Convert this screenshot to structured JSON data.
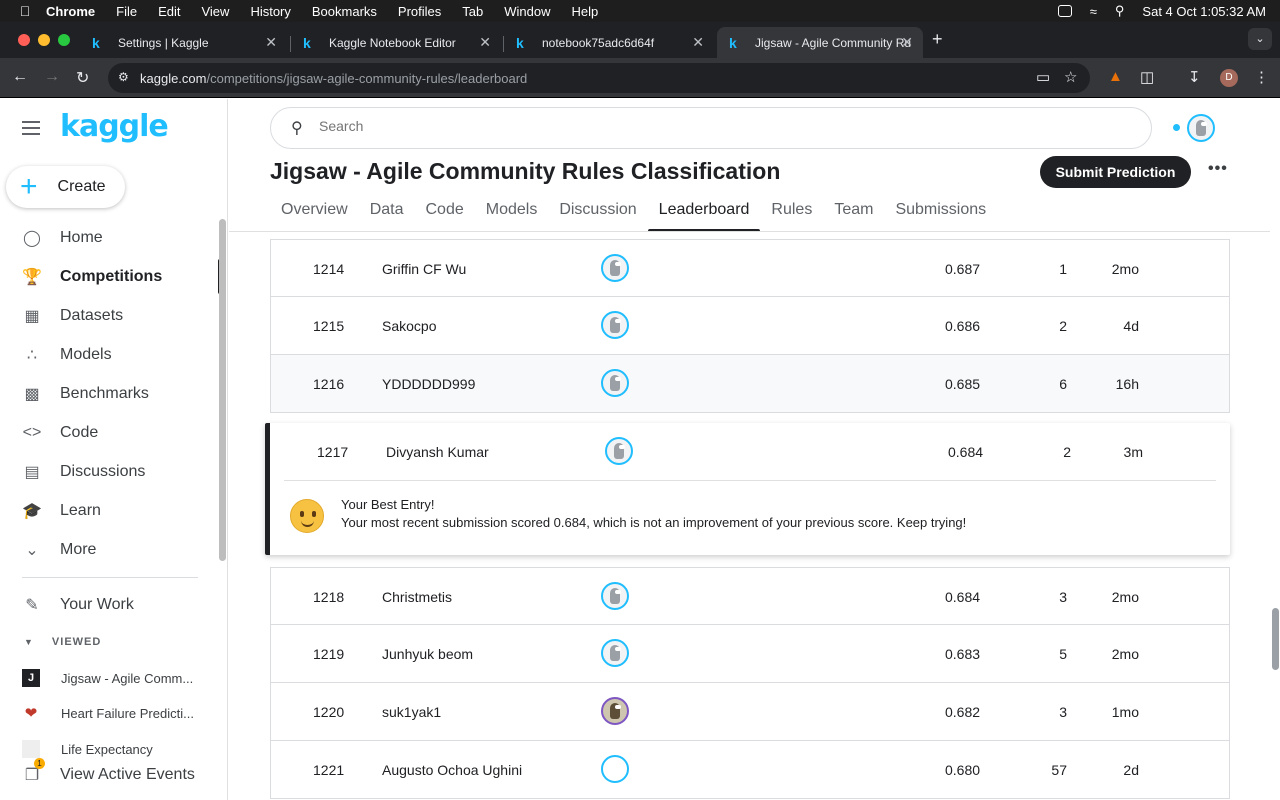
{
  "menubar": {
    "app": "Chrome",
    "items": [
      "File",
      "Edit",
      "View",
      "History",
      "Bookmarks",
      "Profiles",
      "Tab",
      "Window",
      "Help"
    ],
    "clock": "Sat 4 Oct  1:05:32 AM"
  },
  "browser": {
    "tabs": [
      {
        "title": "Settings | Kaggle"
      },
      {
        "title": "Kaggle Notebook Editor"
      },
      {
        "title": "notebook75adc6d64f"
      },
      {
        "title": "Jigsaw - Agile Community Ru"
      }
    ],
    "url_host": "kaggle.com",
    "url_path": "/competitions/jigsaw-agile-community-rules/leaderboard",
    "profile_initial": "D"
  },
  "sidebar": {
    "logo": "kaggle",
    "create_label": "Create",
    "nav": [
      {
        "label": "Home",
        "icon": "compass-icon"
      },
      {
        "label": "Competitions",
        "icon": "trophy-icon"
      },
      {
        "label": "Datasets",
        "icon": "table-icon"
      },
      {
        "label": "Models",
        "icon": "models-icon"
      },
      {
        "label": "Benchmarks",
        "icon": "bar-chart-icon"
      },
      {
        "label": "Code",
        "icon": "code-icon"
      },
      {
        "label": "Discussions",
        "icon": "comment-icon"
      },
      {
        "label": "Learn",
        "icon": "school-icon"
      },
      {
        "label": "More",
        "icon": "chevron-down-icon"
      }
    ],
    "your_work": "Your Work",
    "viewed_heading": "VIEWED",
    "viewed": [
      {
        "label": "Jigsaw - Agile Comm..."
      },
      {
        "label": "Heart Failure Predicti..."
      },
      {
        "label": "Life Expectancy"
      }
    ],
    "active_events": "View Active Events",
    "events_badge": "1"
  },
  "search": {
    "placeholder": "Search"
  },
  "competition": {
    "title": "Jigsaw - Agile Community Rules Classification",
    "submit_label": "Submit Prediction",
    "more_label": "•••",
    "tabs": [
      "Overview",
      "Data",
      "Code",
      "Models",
      "Discussion",
      "Leaderboard",
      "Rules",
      "Team",
      "Submissions"
    ],
    "active_tab": "Leaderboard"
  },
  "leaderboard": {
    "rows_above": [
      {
        "rank": "1214",
        "name": "Griffin CF Wu",
        "score": "0.687",
        "entries": "1",
        "last": "2mo"
      },
      {
        "rank": "1215",
        "name": "Sakocpo",
        "score": "0.686",
        "entries": "2",
        "last": "4d"
      },
      {
        "rank": "1216",
        "name": "YDDDDDD999",
        "score": "0.685",
        "entries": "6",
        "last": "16h"
      }
    ],
    "my_entry": {
      "rank": "1217",
      "name": "Divyansh Kumar",
      "score": "0.684",
      "entries": "2",
      "last": "3m",
      "message_title": "Your Best Entry!",
      "message_body": "Your most recent submission scored 0.684, which is not an improvement of your previous score. Keep trying!"
    },
    "rows_below": [
      {
        "rank": "1218",
        "name": "Christmetis",
        "score": "0.684",
        "entries": "3",
        "last": "2mo"
      },
      {
        "rank": "1219",
        "name": "Junhyuk beom",
        "score": "0.683",
        "entries": "5",
        "last": "2mo"
      },
      {
        "rank": "1220",
        "name": "suk1yak1",
        "score": "0.682",
        "entries": "3",
        "last": "1mo"
      },
      {
        "rank": "1221",
        "name": "Augusto Ochoa Ughini",
        "score": "0.680",
        "entries": "57",
        "last": "2d"
      }
    ]
  },
  "colors": {
    "kaggle_blue": "#20beff",
    "dark": "#202124"
  }
}
